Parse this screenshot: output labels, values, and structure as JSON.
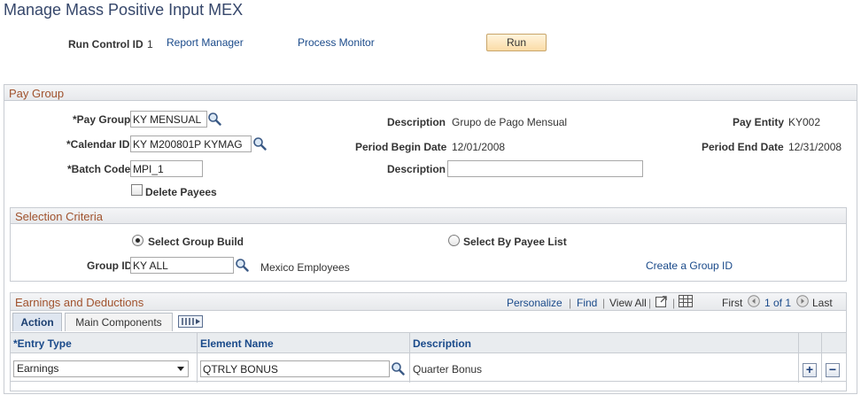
{
  "page": {
    "title": "Manage Mass Positive Input MEX"
  },
  "run_bar": {
    "run_control_label": "Run Control ID",
    "run_control_value": "1",
    "report_manager": "Report Manager",
    "process_monitor": "Process Monitor",
    "run_button": "Run"
  },
  "pay_group": {
    "section_title": "Pay Group",
    "pay_group_label": "*Pay Group",
    "pay_group_value": "KY MENSUAL",
    "description_label": "Description",
    "description_value": "Grupo de Pago Mensual",
    "pay_entity_label": "Pay Entity",
    "pay_entity_value": "KY002",
    "calendar_label": "*Calendar ID",
    "calendar_value": "KY M200801P KYMAG",
    "period_begin_label": "Period Begin Date",
    "period_begin_value": "12/01/2008",
    "period_end_label": "Period End Date",
    "period_end_value": "12/31/2008",
    "batch_label": "*Batch Code",
    "batch_value": "MPI_1",
    "batch_desc_label": "Description",
    "batch_desc_value": "",
    "delete_payees_label": "Delete Payees"
  },
  "selection": {
    "section_title": "Selection Criteria",
    "group_build_label": "Select Group Build",
    "payee_list_label": "Select By Payee List",
    "group_id_label": "Group ID",
    "group_id_value": "KY ALL",
    "group_id_desc": "Mexico Employees",
    "create_group_link": "Create a Group ID"
  },
  "earnings": {
    "section_title": "Earnings and Deductions",
    "personalize": "Personalize",
    "find": "Find",
    "view_all": "View All",
    "first": "First",
    "range": "1 of 1",
    "last": "Last",
    "tabs": [
      {
        "label": "Action"
      },
      {
        "label": "Main Components"
      }
    ],
    "columns": {
      "entry_type": "*Entry Type",
      "element_name": "Element Name",
      "description": "Description"
    },
    "rows": [
      {
        "entry_type": "Earnings",
        "element_name": "QTRLY BONUS",
        "description": "Quarter Bonus"
      }
    ]
  },
  "colors": {
    "title": "#36476b",
    "section_title": "#a0522d",
    "link": "#1a4a8a"
  }
}
